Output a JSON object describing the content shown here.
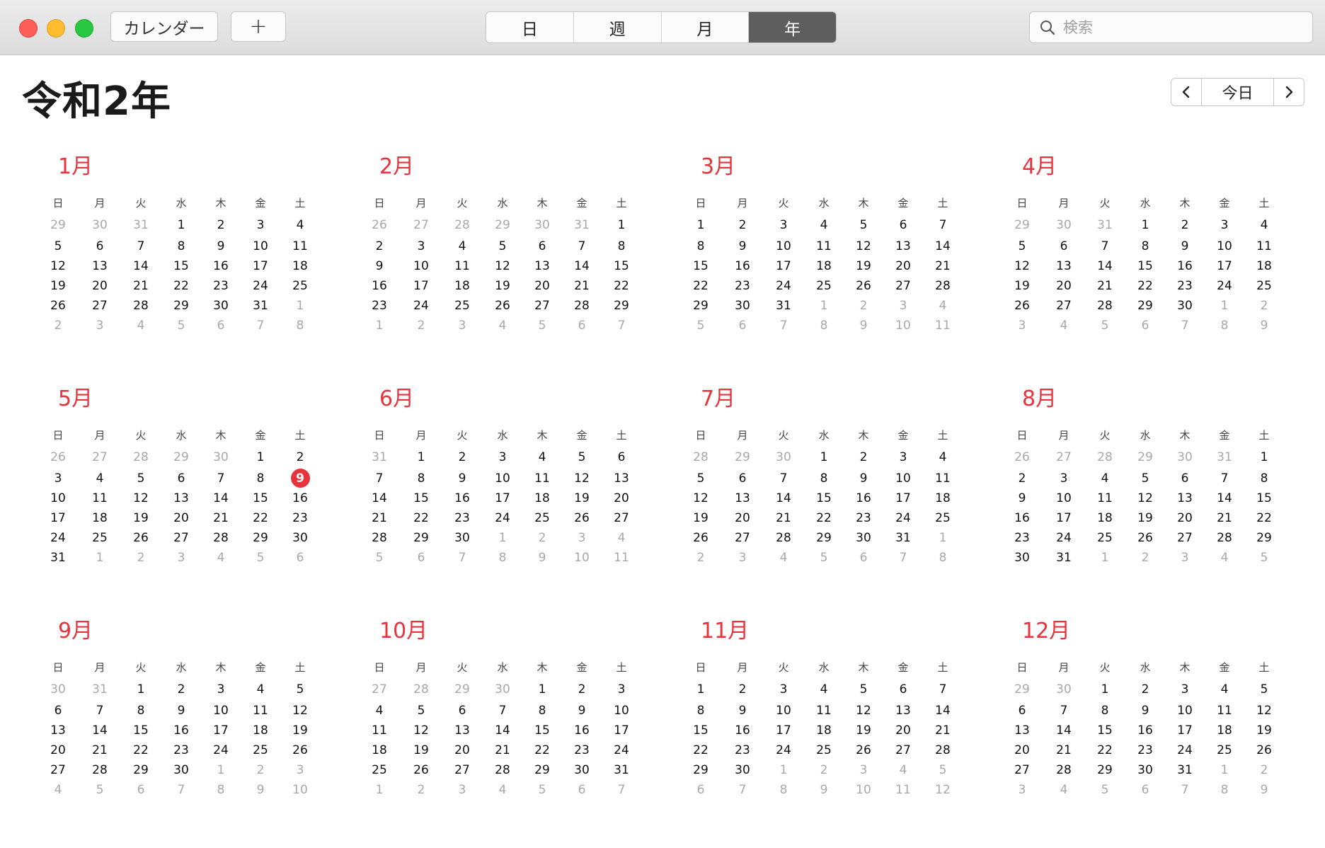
{
  "toolbar": {
    "calendars_label": "カレンダー",
    "add_label": "+",
    "views": [
      "日",
      "週",
      "月",
      "年"
    ],
    "active_view": "年",
    "search_placeholder": "検索"
  },
  "header": {
    "title": "令和2年",
    "today_label": "今日"
  },
  "weekdays": [
    "日",
    "月",
    "火",
    "水",
    "木",
    "金",
    "土"
  ],
  "today": {
    "month": 5,
    "day": 9
  },
  "colors": {
    "accent": "#e8323c",
    "active_segment": "#5e5e5e",
    "muted_day": "#a8a8a8"
  },
  "year": 2020,
  "months": [
    {
      "name": "1月"
    },
    {
      "name": "2月"
    },
    {
      "name": "3月"
    },
    {
      "name": "4月"
    },
    {
      "name": "5月"
    },
    {
      "name": "6月"
    },
    {
      "name": "7月"
    },
    {
      "name": "8月"
    },
    {
      "name": "9月"
    },
    {
      "name": "10月"
    },
    {
      "name": "11月"
    },
    {
      "name": "12月"
    }
  ]
}
